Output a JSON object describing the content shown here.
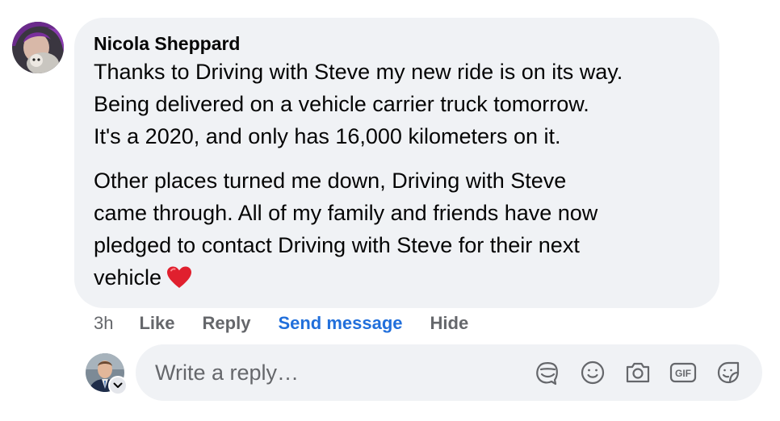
{
  "comment": {
    "author": "Nicola Sheppard",
    "paragraphs": [
      {
        "lines": [
          "Thanks to Driving with Steve my new ride is on its way.",
          "Being delivered on a vehicle carrier truck tomorrow.",
          "It's a 2020, and only has 16,000 kilometers on it."
        ]
      },
      {
        "lines": [
          "Other places turned me down, Driving with Steve",
          "came through. All of my family and friends have now",
          "pledged to contact Driving with Steve for their next",
          "vehicle"
        ]
      }
    ],
    "emoji": "heart-emoji",
    "time": "3h",
    "actions": {
      "like": "Like",
      "reply": "Reply",
      "send_message": "Send message",
      "hide": "Hide"
    }
  },
  "reply_composer": {
    "placeholder": "Write a reply…",
    "icons": [
      "avatar-sticker-icon",
      "emoji-icon",
      "camera-icon",
      "gif-icon",
      "sticker-icon"
    ],
    "gif_label": "GIF"
  },
  "colors": {
    "bubble_bg": "#f0f2f5",
    "link_blue": "#216fdb",
    "muted_text": "#65676b",
    "heart_red": "#e0202e"
  }
}
